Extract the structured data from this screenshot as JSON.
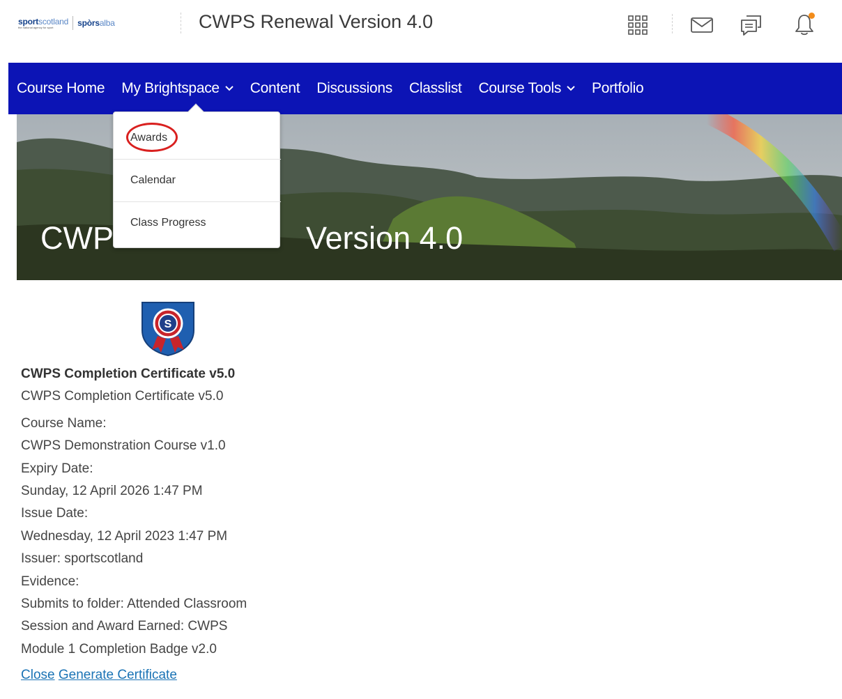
{
  "header": {
    "logo_left": "sportscotland",
    "logo_left_sub": "the national agency for sport",
    "logo_right": "spòrsalba",
    "site_title": "CWPS Renewal Version 4.0",
    "notification_color": "#f28c1b"
  },
  "icons": {
    "apps": "grid-icon",
    "mail": "mail-icon",
    "chat": "chat-icon",
    "notifications": "bell-icon"
  },
  "nav": {
    "items": [
      {
        "label": "Course Home"
      },
      {
        "label": "My Brightspace",
        "has_dropdown": true
      },
      {
        "label": "Content"
      },
      {
        "label": "Discussions"
      },
      {
        "label": "Classlist"
      },
      {
        "label": "Course Tools",
        "has_dropdown": true
      },
      {
        "label": "Portfolio"
      }
    ],
    "background": "#0c14b5"
  },
  "dropdown": {
    "items": [
      {
        "label": "Awards"
      },
      {
        "label": "Calendar"
      },
      {
        "label": "Class Progress"
      }
    ]
  },
  "banner": {
    "title_left": "CWP",
    "title_right": "Version 4.0"
  },
  "award": {
    "badge_letter": "S",
    "title": "CWPS Completion Certificate v5.0",
    "description": "CWPS Completion Certificate v5.0",
    "course_name_label": "Course Name:",
    "course_name": "CWPS Demonstration Course v1.0",
    "expiry_label": "Expiry Date:",
    "expiry": "Sunday, 12 April 2026 1:47 PM",
    "issue_label": "Issue Date:",
    "issue": "Wednesday, 12 April 2023 1:47 PM",
    "issuer": "Issuer:  sportscotland",
    "evidence_label": "Evidence:",
    "evidence_line1": "Submits to folder: Attended Classroom",
    "evidence_line2": "Session and Award Earned: CWPS",
    "evidence_line3": "Module 1 Completion Badge v2.0"
  },
  "actions": {
    "close": "Close",
    "generate": "Generate Certificate"
  }
}
